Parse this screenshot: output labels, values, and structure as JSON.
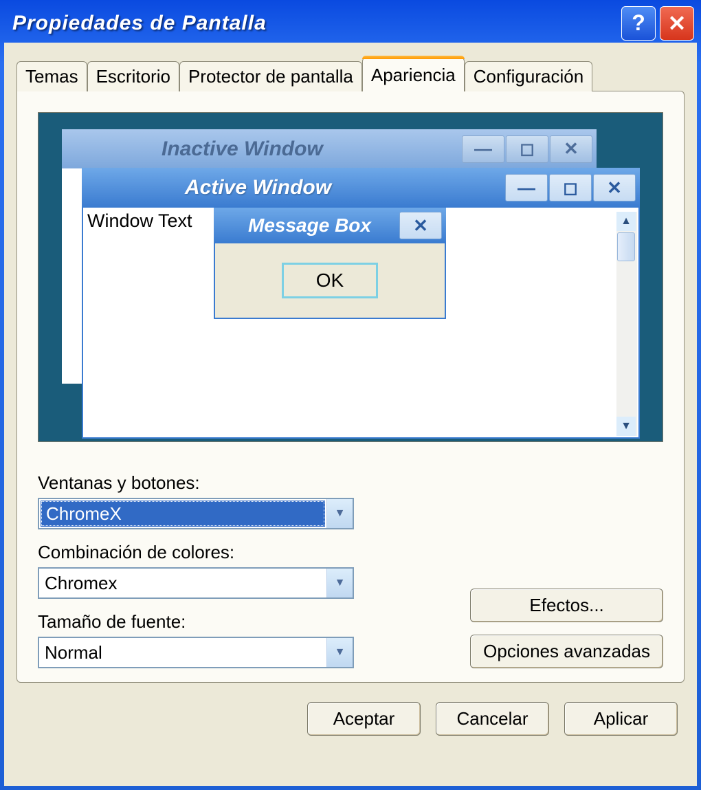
{
  "titlebar": {
    "title": "Propiedades de Pantalla"
  },
  "tabs": {
    "items": [
      {
        "label": "Temas"
      },
      {
        "label": "Escritorio"
      },
      {
        "label": "Protector de pantalla"
      },
      {
        "label": "Apariencia"
      },
      {
        "label": "Configuración"
      }
    ],
    "active_index": 3
  },
  "preview": {
    "inactive_window_title": "Inactive Window",
    "active_window_title": "Active Window",
    "window_text": "Window Text",
    "message_box_title": "Message Box",
    "ok_label": "OK"
  },
  "form": {
    "windows_buttons_label": "Ventanas y botones:",
    "windows_buttons_value": "ChromeX",
    "color_scheme_label": "Combinación de colores:",
    "color_scheme_value": "Chromex",
    "font_size_label": "Tamaño de fuente:",
    "font_size_value": "Normal",
    "effects_button": "Efectos...",
    "advanced_button": "Opciones avanzadas"
  },
  "buttons": {
    "ok": "Aceptar",
    "cancel": "Cancelar",
    "apply": "Aplicar"
  }
}
